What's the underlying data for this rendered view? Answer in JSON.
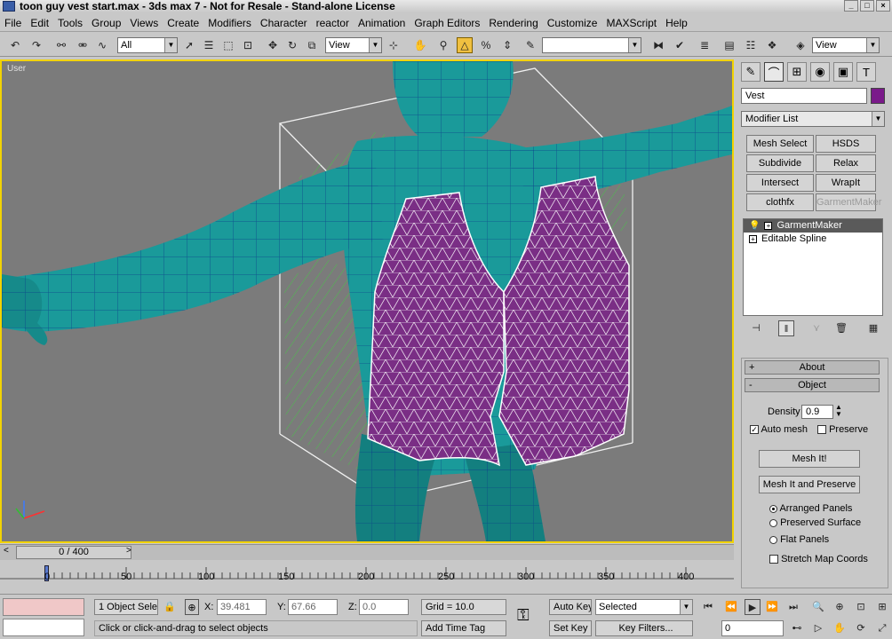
{
  "window": {
    "title": "toon guy vest start.max - 3ds max 7 - Not for Resale - Stand-alone License",
    "minimize": "_",
    "maximize": "□",
    "close": "×"
  },
  "menu": [
    "File",
    "Edit",
    "Tools",
    "Group",
    "Views",
    "Create",
    "Modifiers",
    "Character",
    "reactor",
    "Animation",
    "Graph Editors",
    "Rendering",
    "Customize",
    "MAXScript",
    "Help"
  ],
  "toolbar": {
    "selection_filter": "All",
    "ref_coord_left": "View",
    "named_selection": "",
    "ref_coord_right": "View"
  },
  "viewport": {
    "label": "User",
    "colors": {
      "body": "#1a9a9a",
      "vest": "#7a2e85",
      "border": "#f2d300",
      "background": "#7b7b7b"
    }
  },
  "panel": {
    "object_name": "Vest",
    "object_color": "#7a1a8a",
    "modifier_list": "Modifier List",
    "buttons": {
      "mesh_select": "Mesh Select",
      "hsds": "HSDS",
      "subdivide": "Subdivide",
      "relax": "Relax",
      "intersect": "Intersect",
      "wrapit": "WrapIt",
      "clothfx": "clothfx",
      "garmentmaker": "GarmentMaker"
    },
    "stack": [
      "GarmentMaker",
      "Editable Spline"
    ],
    "rollouts": {
      "about": "About",
      "about_sign": "+",
      "object": "Object",
      "object_sign": "-"
    },
    "density_label": "Density",
    "density_value": "0.9",
    "auto_mesh": "Auto mesh",
    "preserve": "Preserve",
    "mesh_it": "Mesh It!",
    "mesh_it_preserve": "Mesh It and Preserve",
    "radio": [
      "Arranged Panels",
      "Preserved Surface",
      "Flat Panels"
    ],
    "stretch_map": "Stretch Map Coords"
  },
  "timeline": {
    "frame_label": "0 / 400",
    "ticks": [
      "0",
      "50",
      "100",
      "150",
      "200",
      "250",
      "300",
      "350",
      "400"
    ]
  },
  "status": {
    "selection": "1 Object Selec",
    "x_label": "X:",
    "x_value": "39.481",
    "y_label": "Y:",
    "y_value": "67.66",
    "z_label": "Z:",
    "z_value": "0.0",
    "grid": "Grid = 10.0",
    "prompt": "Click or click-and-drag to select objects",
    "add_time_tag": "Add Time Tag",
    "auto_key": "Auto Key",
    "set_key": "Set Key",
    "selected": "Selected",
    "key_filters": "Key Filters...",
    "current_frame": "0"
  }
}
